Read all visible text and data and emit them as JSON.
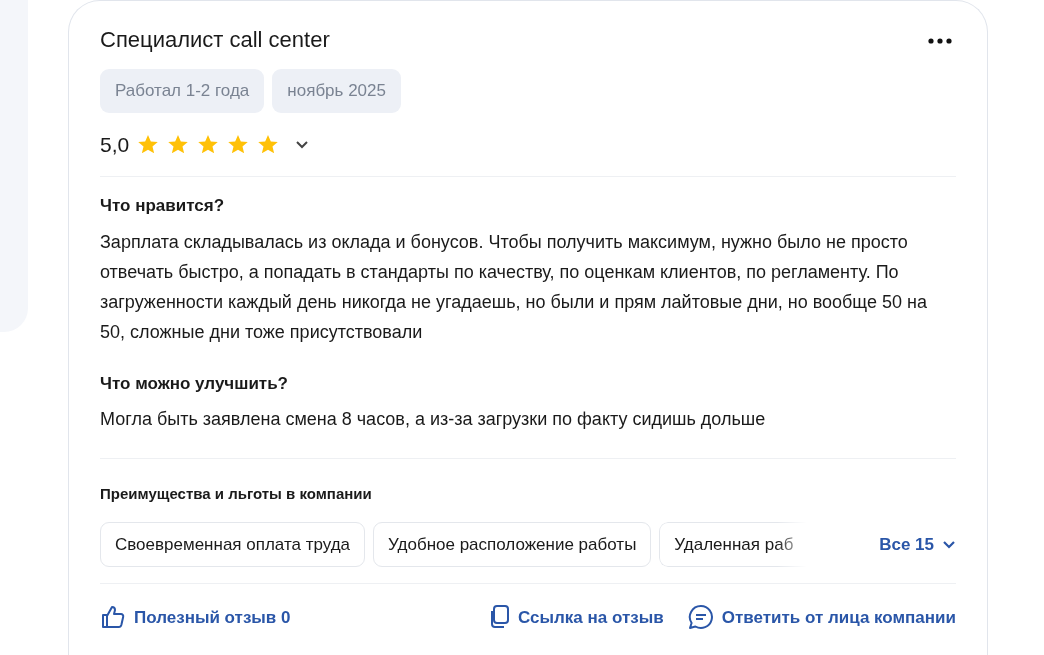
{
  "review": {
    "title": "Специалист call center",
    "tags": [
      "Работал 1-2 года",
      "ноябрь 2025"
    ],
    "rating": {
      "value": "5,0",
      "stars": 5
    },
    "sections": [
      {
        "heading": "Что нравится?",
        "text": "Зарплата складывалась из оклада и бонусов. Чтобы получить максимум, нужно было не просто отвечать быстро, а попадать в стандарты по качеству, по оценкам клиентов, по регламенту. По загруженности каждый день никогда не угадаешь, но были и прям лайтовые дни, но вообще 50 на 50, сложные дни тоже присутствовали"
      },
      {
        "heading": "Что можно улучшить?",
        "text": "Могла быть заявлена смена 8 часов, а из-за загрузки по факту сидишь дольше"
      }
    ],
    "benefits": {
      "heading": "Преимущества и льготы в компании",
      "chips": [
        "Своевременная оплата труда",
        "Удобное расположение работы",
        "Удаленная раб"
      ],
      "more": "Все 15"
    },
    "actions": [
      {
        "kind": "like",
        "label": "Полезный отзыв 0"
      },
      {
        "kind": "link",
        "label": "Ссылка на отзыв"
      },
      {
        "kind": "reply",
        "label": "Ответить от лица компании"
      }
    ]
  }
}
